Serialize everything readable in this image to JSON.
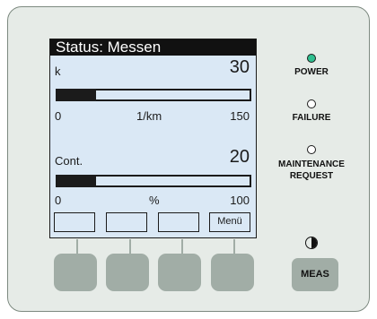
{
  "display": {
    "title": "Status: Messen",
    "gauges": [
      {
        "label": "k",
        "value": "30",
        "min": "0",
        "unit": "1/km",
        "max": "150",
        "fraction": 0.2
      },
      {
        "label": "Cont.",
        "value": "20",
        "min": "0",
        "unit": "%",
        "max": "100",
        "fraction": 0.2
      }
    ],
    "softkeys": [
      "",
      "",
      "",
      "Menü"
    ]
  },
  "indicators": {
    "power": {
      "label": "POWER",
      "color": "#2fbf8f",
      "state": "on"
    },
    "failure": {
      "label": "FAILURE",
      "color": "#ffffff",
      "state": "off"
    },
    "maintenance": {
      "label": "MAINTENANCE REQUEST",
      "color": "#ffffff",
      "state": "off"
    }
  },
  "controls": {
    "contrast_icon": "contrast-icon",
    "meas_label": "MEAS"
  }
}
